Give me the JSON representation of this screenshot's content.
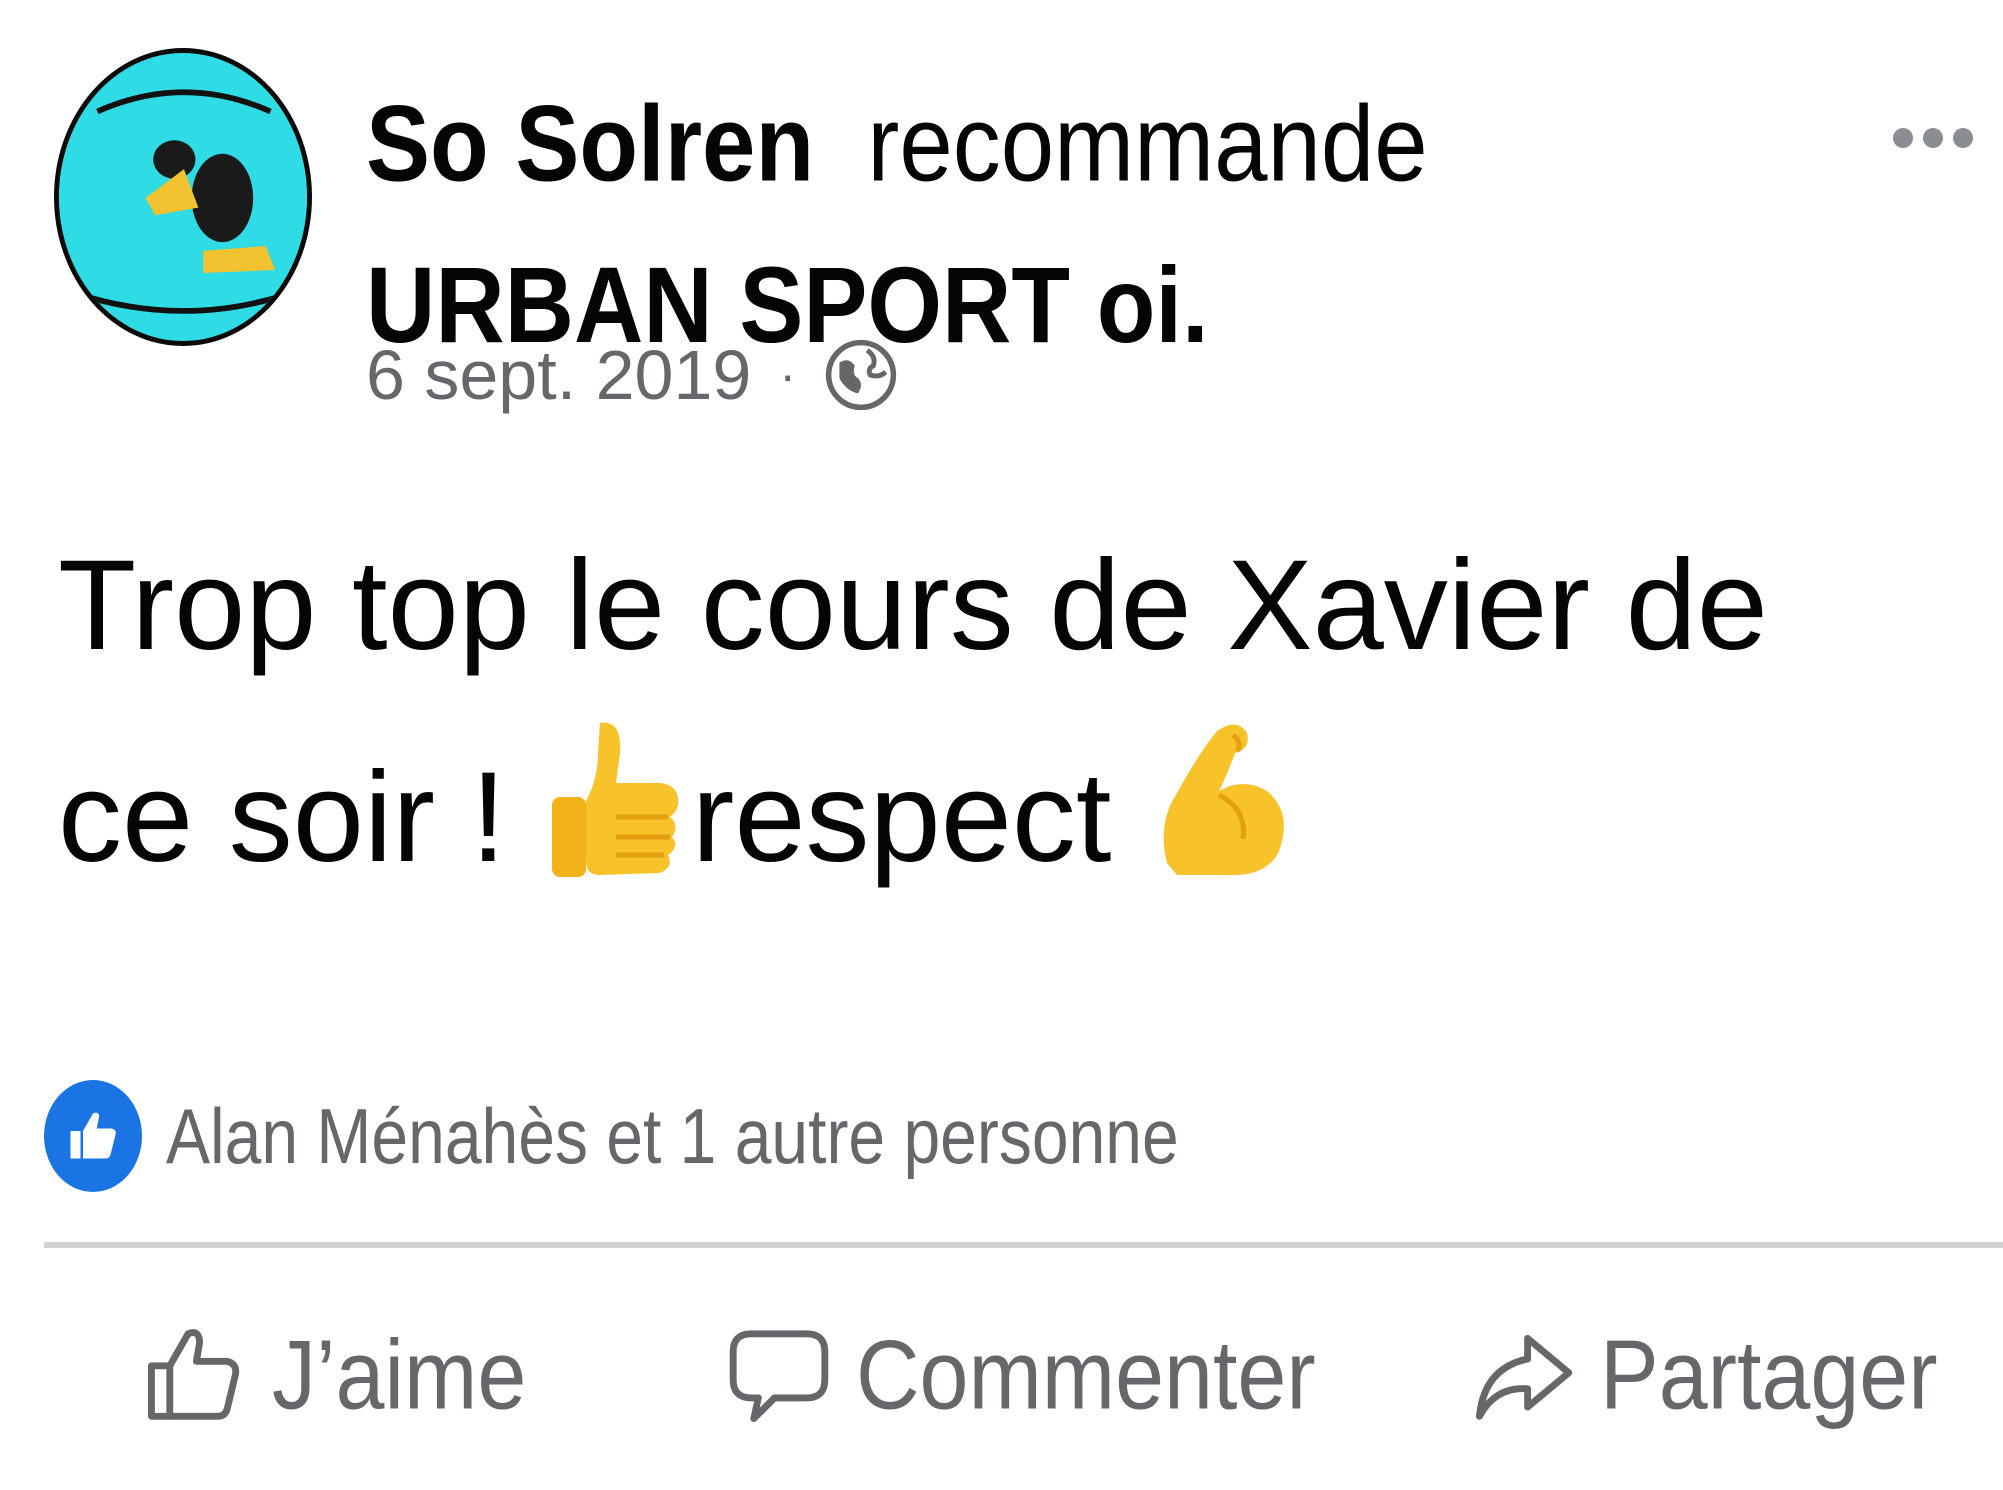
{
  "post": {
    "author": "So Solren",
    "verb": "recommande",
    "page": "URBAN SPORT oi.",
    "date": "6 sept. 2019",
    "separator": "·",
    "audience_icon": "globe-icon",
    "message_line1": "Trop top le cours de Xavier de",
    "message_line2a": "ce soir ! ",
    "message_line2b": "respect ",
    "emoji_1": "thumbs-up",
    "emoji_2": "flexed-biceps"
  },
  "reactions": {
    "icon": "like-badge-icon",
    "text": "Alan Ménahès et 1 autre personne"
  },
  "actions": {
    "like": "J’aime",
    "comment": "Commenter",
    "share": "Partager"
  },
  "colors": {
    "avatar_bg": "#2fdce6",
    "facebook_blue": "#1b74e4",
    "secondary_text": "#65676b",
    "emoji_yellow": "#f7c22a"
  }
}
